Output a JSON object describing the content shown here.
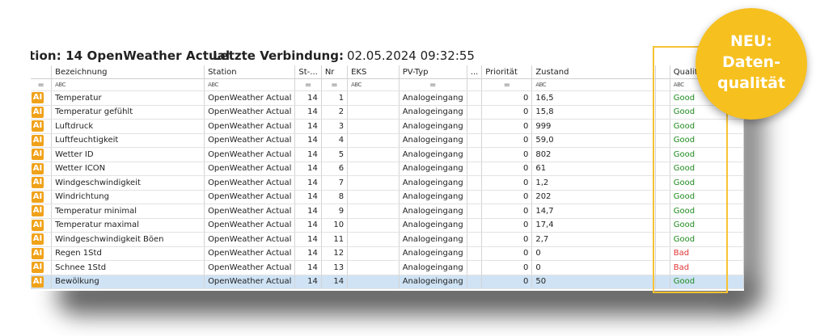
{
  "header": {
    "station_title": "tion: 14 OpenWeather Actual",
    "connection_label": "Letzte Verbindung:",
    "connection_value": "02.05.2024 09:32:55"
  },
  "columns": [
    "",
    "Bezeichnung",
    "Station",
    "St-...",
    "Nr",
    "EKS",
    "PV-Typ",
    "...",
    "Priorität",
    "Zustand",
    "",
    "Qualität"
  ],
  "filter_row": [
    "=",
    "ABC",
    "ABC",
    "=",
    "=",
    "ABC",
    "=",
    "",
    "=",
    "ABC",
    "",
    "ABC"
  ],
  "rows": [
    {
      "type": "AI",
      "name": "Temperatur",
      "station": "OpenWeather Actual",
      "st": "14",
      "nr": "1",
      "eks": "",
      "pv": "Analogeingang",
      "prio": "0",
      "state": "16,5",
      "quality": "Good"
    },
    {
      "type": "AI",
      "name": "Temperatur gefühlt",
      "station": "OpenWeather Actual",
      "st": "14",
      "nr": "2",
      "eks": "",
      "pv": "Analogeingang",
      "prio": "0",
      "state": "15,8",
      "quality": "Good"
    },
    {
      "type": "AI",
      "name": "Luftdruck",
      "station": "OpenWeather Actual",
      "st": "14",
      "nr": "3",
      "eks": "",
      "pv": "Analogeingang",
      "prio": "0",
      "state": "999",
      "quality": "Good"
    },
    {
      "type": "AI",
      "name": "Luftfeuchtigkeit",
      "station": "OpenWeather Actual",
      "st": "14",
      "nr": "4",
      "eks": "",
      "pv": "Analogeingang",
      "prio": "0",
      "state": "59,0",
      "quality": "Good"
    },
    {
      "type": "AI",
      "name": "Wetter ID",
      "station": "OpenWeather Actual",
      "st": "14",
      "nr": "5",
      "eks": "",
      "pv": "Analogeingang",
      "prio": "0",
      "state": "802",
      "quality": "Good"
    },
    {
      "type": "AI",
      "name": "Wetter ICON",
      "station": "OpenWeather Actual",
      "st": "14",
      "nr": "6",
      "eks": "",
      "pv": "Analogeingang",
      "prio": "0",
      "state": "61",
      "quality": "Good"
    },
    {
      "type": "AI",
      "name": "Windgeschwindigkeit",
      "station": "OpenWeather Actual",
      "st": "14",
      "nr": "7",
      "eks": "",
      "pv": "Analogeingang",
      "prio": "0",
      "state": "1,2",
      "quality": "Good"
    },
    {
      "type": "AI",
      "name": "Windrichtung",
      "station": "OpenWeather Actual",
      "st": "14",
      "nr": "8",
      "eks": "",
      "pv": "Analogeingang",
      "prio": "0",
      "state": "202",
      "quality": "Good"
    },
    {
      "type": "AI",
      "name": "Temperatur minimal",
      "station": "OpenWeather Actual",
      "st": "14",
      "nr": "9",
      "eks": "",
      "pv": "Analogeingang",
      "prio": "0",
      "state": "14,7",
      "quality": "Good"
    },
    {
      "type": "AI",
      "name": "Temperatur maximal",
      "station": "OpenWeather Actual",
      "st": "14",
      "nr": "10",
      "eks": "",
      "pv": "Analogeingang",
      "prio": "0",
      "state": "17,4",
      "quality": "Good"
    },
    {
      "type": "AI",
      "name": "Windgeschwindigkeit Böen",
      "station": "OpenWeather Actual",
      "st": "14",
      "nr": "11",
      "eks": "",
      "pv": "Analogeingang",
      "prio": "0",
      "state": "2,7",
      "quality": "Good"
    },
    {
      "type": "AI",
      "name": "Regen 1Std",
      "station": "OpenWeather Actual",
      "st": "14",
      "nr": "12",
      "eks": "",
      "pv": "Analogeingang",
      "prio": "0",
      "state": "0",
      "quality": "Bad"
    },
    {
      "type": "AI",
      "name": "Schnee 1Std",
      "station": "OpenWeather Actual",
      "st": "14",
      "nr": "13",
      "eks": "",
      "pv": "Analogeingang",
      "prio": "0",
      "state": "0",
      "quality": "Bad"
    },
    {
      "type": "AI",
      "name": "Bewölkung",
      "station": "OpenWeather Actual",
      "st": "14",
      "nr": "14",
      "eks": "",
      "pv": "Analogeingang",
      "prio": "0",
      "state": "50",
      "quality": "Good",
      "selected": true
    }
  ],
  "badge": {
    "line1": "NEU:",
    "line2": "Daten-",
    "line3": "qualität"
  },
  "colors": {
    "accent": "#f6c01f",
    "ai_badge": "#f0a21a",
    "good": "#1e8a1e",
    "bad": "#e03535",
    "selected_row": "#cfe3f5"
  }
}
